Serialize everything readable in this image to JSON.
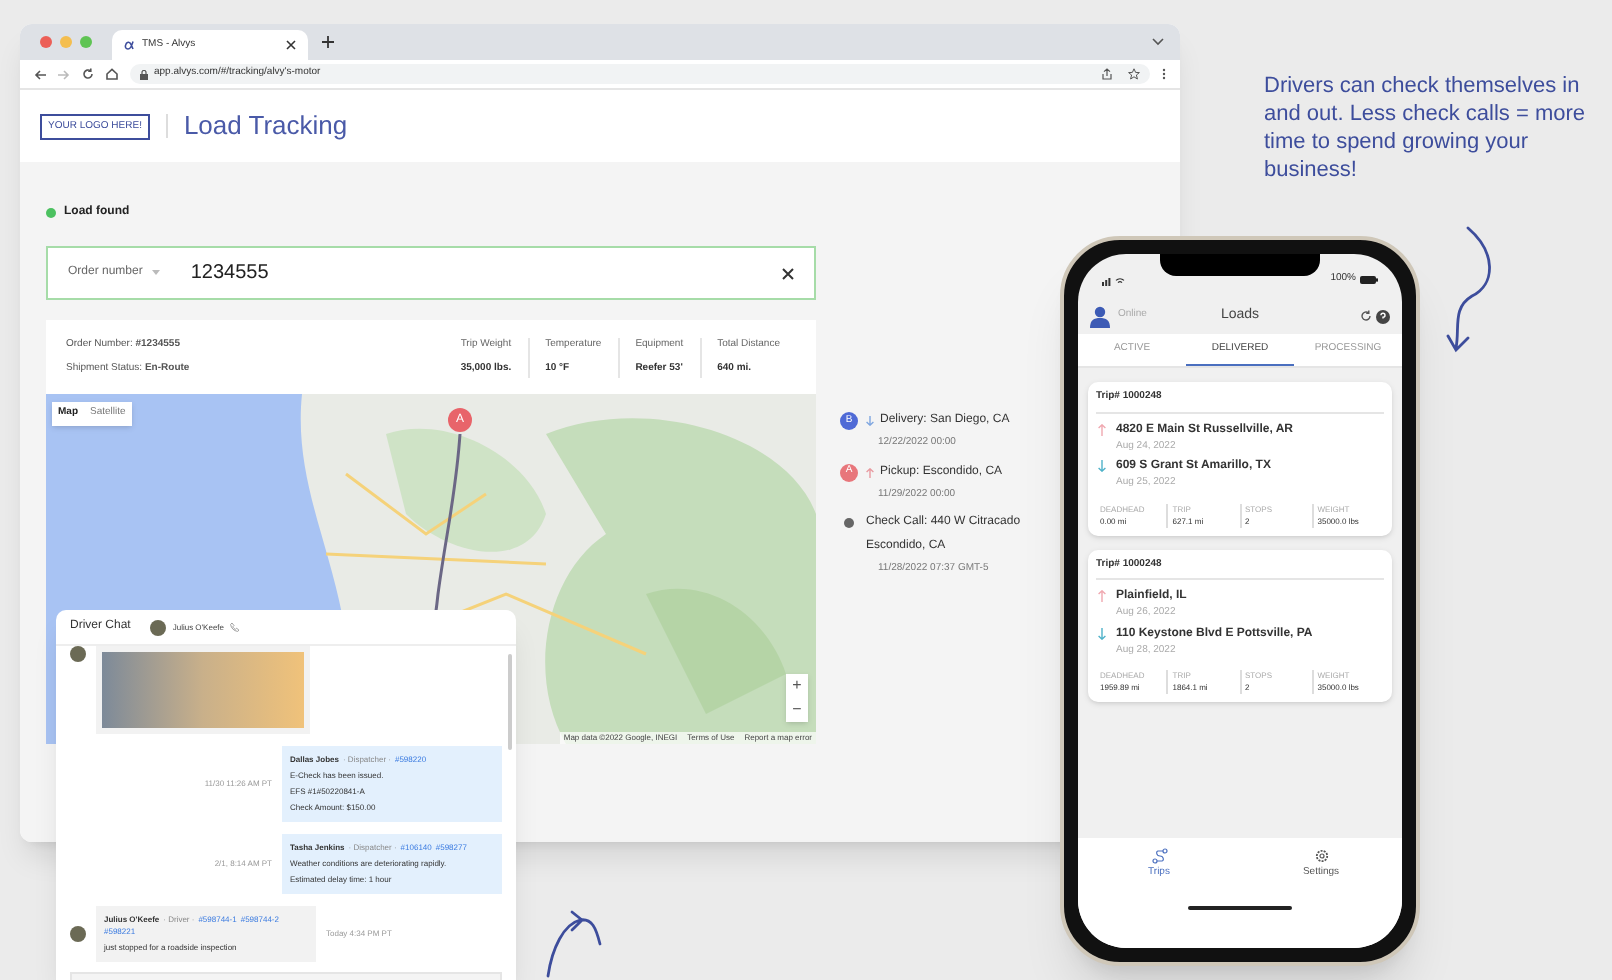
{
  "browser": {
    "tab_title": "TMS - Alvys",
    "url": "app.alvys.com/#/tracking/alvy's-motor"
  },
  "header": {
    "logo": "YOUR LOGO HERE!",
    "title": "Load Tracking"
  },
  "status": {
    "text": "Load found"
  },
  "search": {
    "label": "Order number",
    "value": "1234555"
  },
  "order": {
    "lines": [
      "Order Number: **#1234555**",
      "Shipment Status: **En-Route**"
    ],
    "stats": [
      {
        "label": "Trip Weight",
        "value": "35,000 lbs."
      },
      {
        "label": "Temperature",
        "value": "10 °F"
      },
      {
        "label": "Equipment",
        "value": "Reefer 53'"
      },
      {
        "label": "Total Distance",
        "value": "640 mi."
      }
    ]
  },
  "map": {
    "view_tabs": [
      {
        "label": "Map",
        "selected": true
      },
      {
        "label": "Satellite",
        "selected": false
      }
    ],
    "marker": "A",
    "zoom_controls": [
      "+",
      "−"
    ],
    "attribution": [
      "Map data ©2022 Google, INEGI",
      "Terms of Use",
      "Report a map error"
    ]
  },
  "timeline": [
    {
      "kind": "delivery",
      "badge": "B",
      "title": "Delivery: San Diego, CA",
      "time": "12/22/2022 00:00"
    },
    {
      "kind": "pickup",
      "badge": "A",
      "title": "Pickup: Escondido, CA",
      "time": "11/29/2022 00:00"
    },
    {
      "kind": "check_call",
      "title": "Check Call: 440 W Citracado",
      "subtitle": "Escondido, CA",
      "time": "11/28/2022 07:37 GMT-5"
    }
  ],
  "chat": {
    "title": "Driver Chat",
    "contact": "Julius O'Keefe",
    "messages": [
      {
        "kind": "photo",
        "outgoing": false
      },
      {
        "kind": "text",
        "outgoing": true,
        "author": "Dallas Jobes",
        "role": "· Dispatcher ·",
        "refs": [
          "#598220"
        ],
        "lines": [
          "E-Check has been issued.",
          "EFS #1#50220841-A",
          "Check Amount: $150.00"
        ],
        "time": "11/30 11:26 AM PT"
      },
      {
        "kind": "text",
        "outgoing": true,
        "author": "Tasha Jenkins",
        "role": "· Dispatcher ·",
        "refs": [
          "#106140",
          "#598277"
        ],
        "lines": [
          "Weather conditions are deteriorating rapidly.",
          "Estimated delay time: 1 hour"
        ],
        "time": "2/1, 8:14 AM PT"
      },
      {
        "kind": "text",
        "outgoing": false,
        "author": "Julius O'Keefe",
        "role": "· Driver ·",
        "refs": [
          "#598744-1",
          "#598744-2",
          "#598221"
        ],
        "lines": [
          "just stopped for a roadside inspection"
        ],
        "time": "Today 4:34 PM PT"
      }
    ]
  },
  "phone": {
    "battery": "100%",
    "presence": "Online",
    "title": "Loads",
    "tabs": [
      {
        "label": "ACTIVE",
        "selected": false
      },
      {
        "label": "DELIVERED",
        "selected": true
      },
      {
        "label": "PROCESSING",
        "selected": false
      }
    ],
    "trips": [
      {
        "title": "Trip# 1000248",
        "stops": [
          {
            "kind": "pickup",
            "address": "4820 E Main St Russellville, AR",
            "date": "Aug 24, 2022"
          },
          {
            "kind": "drop",
            "address": "609 S Grant St Amarillo, TX",
            "date": "Aug 25, 2022"
          }
        ],
        "stats": [
          {
            "label": "DEADHEAD",
            "value": "0.00 mi"
          },
          {
            "label": "TRIP",
            "value": "627.1 mi"
          },
          {
            "label": "STOPS",
            "value": "2"
          },
          {
            "label": "WEIGHT",
            "value": "35000.0 lbs"
          }
        ]
      },
      {
        "title": "Trip# 1000248",
        "stops": [
          {
            "kind": "pickup",
            "address": "Plainfield, IL",
            "date": "Aug 26, 2022"
          },
          {
            "kind": "drop",
            "address": "110 Keystone Blvd E Pottsville, PA",
            "date": "Aug 28, 2022"
          }
        ],
        "stats": [
          {
            "label": "DEADHEAD",
            "value": "1959.89 mi"
          },
          {
            "label": "TRIP",
            "value": "1864.1 mi"
          },
          {
            "label": "STOPS",
            "value": "2"
          },
          {
            "label": "WEIGHT",
            "value": "35000.0 lbs"
          }
        ]
      }
    ],
    "nav": [
      {
        "label": "Trips",
        "selected": true
      },
      {
        "label": "Settings",
        "selected": false
      }
    ]
  },
  "callout": "Drivers can check themselves in and out. Less check calls = more time to spend growing your business!"
}
